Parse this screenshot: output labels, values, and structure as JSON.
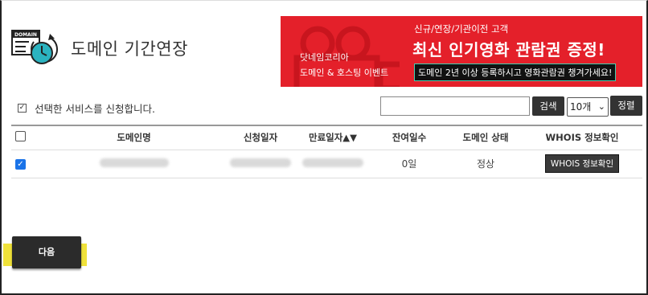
{
  "page": {
    "title": "도메인 기간연장"
  },
  "icon": {
    "label": "DOMAIN",
    "name": "domain-clock-icon"
  },
  "banner": {
    "left_line1": "닷네임코리아",
    "left_line2": "도메인 & 호스팅 이벤트",
    "sub": "신규/연장/기관이전 고객",
    "main": "최신 인기영화 관람권 증정!",
    "note": "도메인 2년 이상 등록하시고 영화관람권 챙겨가세요!",
    "color": "#e4202a"
  },
  "agree": {
    "label": "선택한 서비스를 신청합니다.",
    "checked": true
  },
  "search": {
    "value": "",
    "button_label": "검색"
  },
  "page_size": {
    "selected": "10개"
  },
  "sort_label": "정렬",
  "table": {
    "headers": [
      "도메인명",
      "신청일자",
      "만료일자▲▼",
      "잔여일수",
      "도메인 상태",
      "WHOIS 정보확인"
    ],
    "rows": [
      {
        "checked": true,
        "remaining": "0일",
        "status": "정상",
        "whois_label": "WHOIS 정보확인"
      }
    ]
  },
  "next_button": {
    "label": "다음"
  },
  "colors": {
    "accent": "#5b3fa1",
    "highlight": "#f0e23a"
  }
}
